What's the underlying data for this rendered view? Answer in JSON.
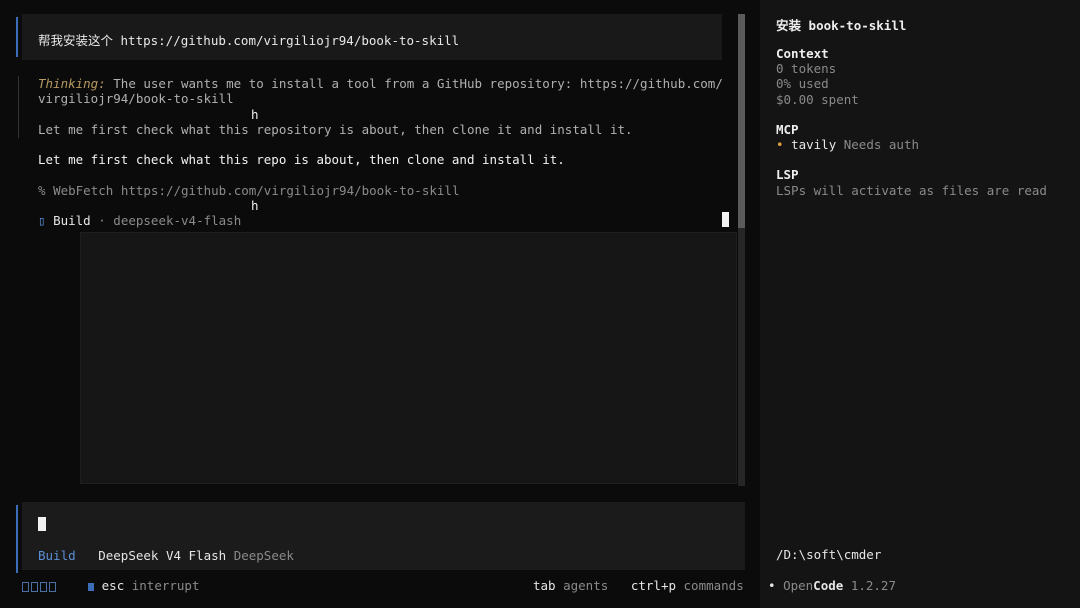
{
  "conversation": {
    "user_message": "帮我安装这个 https://github.com/virgiliojr94/book-to-skill",
    "thinking_label": "Thinking:",
    "thinking_line1": "The user wants me to install a tool from a GitHub repository: https://github.com/",
    "thinking_line2": "virgiliojr94/book-to-skill",
    "thinking_stray_h": "h",
    "thinking_line3": "Let me first check what this repository is about, then clone it and install it.",
    "assistant_text": "Let me first check what this repo is about, then clone and install it.",
    "tool_prefix": "%",
    "tool_name": "WebFetch",
    "tool_url": "https://github.com/virgiliojr94/book-to-skill",
    "tool_stray_h": "h",
    "build_icon": "▯",
    "build_label": "Build",
    "build_separator": "·",
    "build_model": "deepseek-v4-flash"
  },
  "input": {
    "mode_label": "Build",
    "model_name": "DeepSeek V4 Flash",
    "provider": "DeepSeek"
  },
  "footer": {
    "key_escape": "esc",
    "interrupt_label": "interrupt",
    "key_tab": "tab",
    "agents_label": "agents",
    "key_commands": "ctrl+p",
    "commands_label": "commands"
  },
  "sidebar": {
    "title_prefix": "安装",
    "title_name": "book-to-skill",
    "context_heading": "Context",
    "tokens": "0 tokens",
    "used": "0% used",
    "spent": "$0.00 spent",
    "mcp_heading": "MCP",
    "mcp_bullet": "•",
    "mcp_server": "tavily",
    "mcp_status": "Needs auth",
    "lsp_heading": "LSP",
    "lsp_status": "LSPs will activate as files are read",
    "path": "/D:\\soft\\cmder",
    "app_bullet": "•",
    "app_name_open": "Open",
    "app_name_code": "Code",
    "app_version": "1.2.27"
  },
  "colors": {
    "accent": "#3b6db8",
    "thinking_label": "#b79a62",
    "mcp_dot": "#e0a040"
  }
}
